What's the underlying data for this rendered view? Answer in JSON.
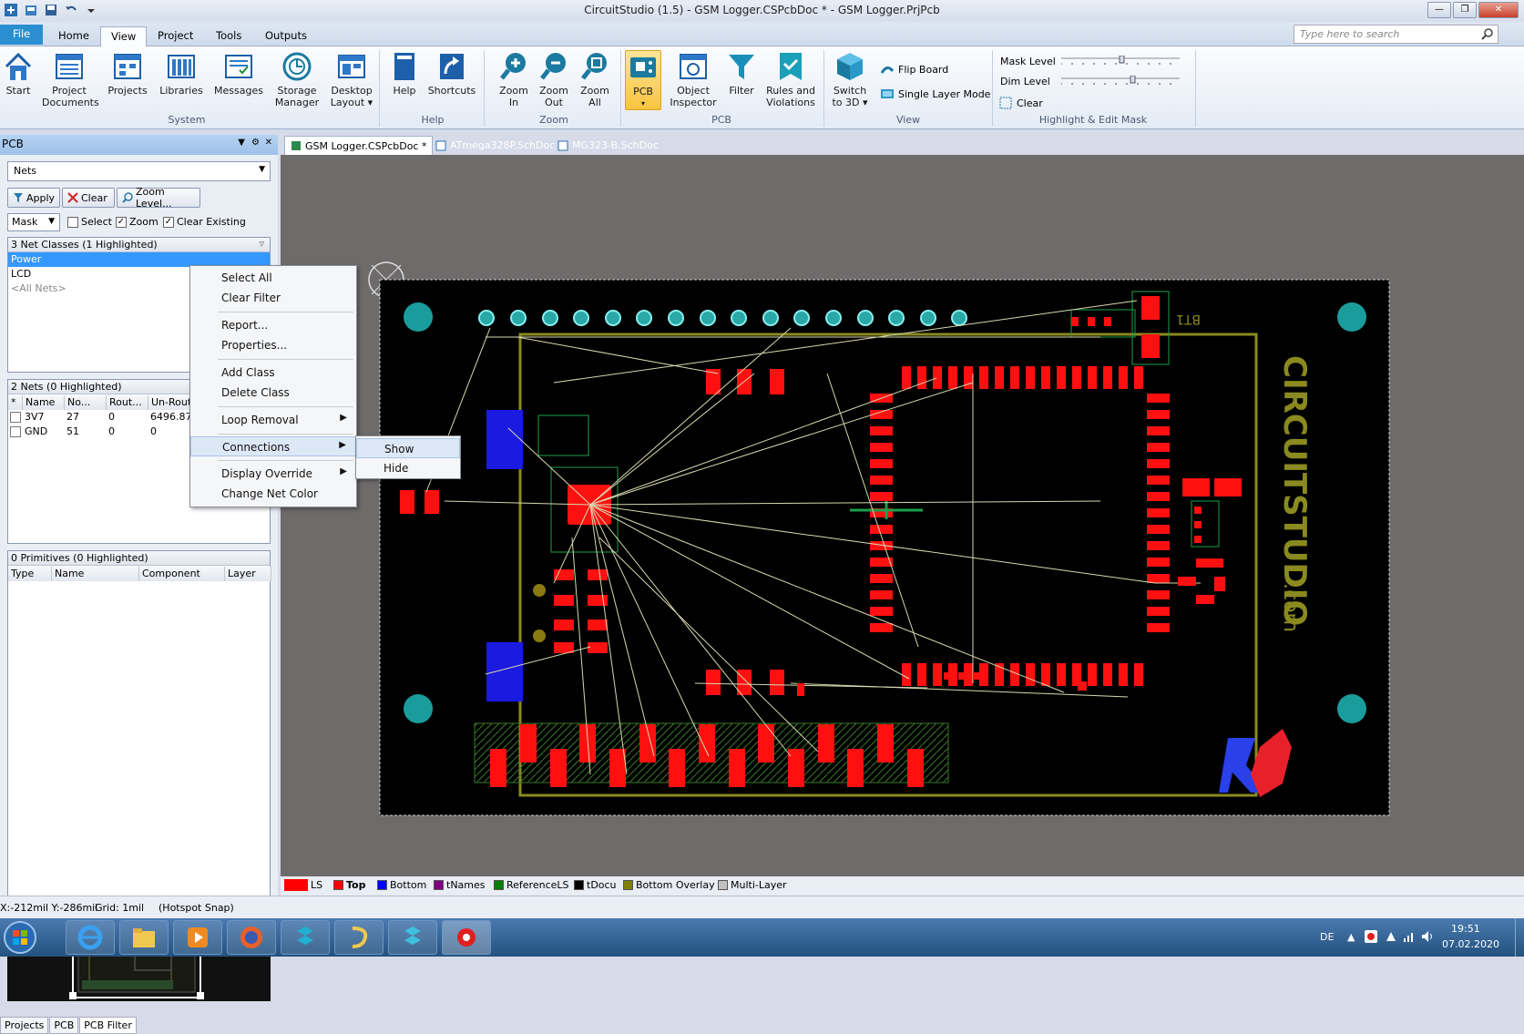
{
  "window": {
    "title": "CircuitStudio (1.5) - GSM Logger.CSPcbDoc * - GSM Logger.PrjPcb"
  },
  "ribbon_tabs": [
    "File",
    "Home",
    "View",
    "Project",
    "Tools",
    "Outputs"
  ],
  "search": {
    "placeholder": "Type here to search"
  },
  "ribbon": {
    "start": "Start",
    "project_documents": [
      "Project",
      "Documents"
    ],
    "projects": "Projects",
    "libraries": "Libraries",
    "messages": "Messages",
    "storage_manager": [
      "Storage",
      "Manager"
    ],
    "desktop_layout": [
      "Desktop",
      "Layout ▾"
    ],
    "help": "Help",
    "shortcuts": "Shortcuts",
    "zoom_in": [
      "Zoom",
      "In"
    ],
    "zoom_out": [
      "Zoom",
      "Out"
    ],
    "zoom_all": [
      "Zoom",
      "All"
    ],
    "pcb": "PCB",
    "object_inspector": [
      "Object",
      "Inspector"
    ],
    "filter": "Filter",
    "rules": [
      "Rules and",
      "Violations"
    ],
    "switch_3d": [
      "Switch",
      "to 3D ▾"
    ],
    "flip_board": "Flip Board",
    "single_layer": "Single Layer Mode",
    "mask_level": "Mask Level",
    "dim_level": "Dim Level",
    "clear": "Clear",
    "groups": {
      "system": "System",
      "help": "Help",
      "zoom": "Zoom",
      "pcb": "PCB",
      "view": "View",
      "highlight": "Highlight & Edit Mask"
    }
  },
  "panel": {
    "title": "PCB",
    "mode": "Nets",
    "apply": "Apply",
    "clear": "Clear",
    "zoom_level": "Zoom Level...",
    "mask": "Mask",
    "select": "Select",
    "zoom": "Zoom",
    "clear_existing": "Clear Existing",
    "net_classes_header": "3 Net Classes (1 Highlighted)",
    "net_classes": [
      "Power",
      "LCD",
      "<All Nets>"
    ],
    "nets_header": "2 Nets (0 Highlighted)",
    "nets_columns": [
      "*",
      "Name",
      "No...",
      "Rout...",
      "Un-Rout"
    ],
    "nets": [
      {
        "name": "3V7",
        "nodes": "27",
        "routed": "0",
        "unrouted": "6496.872"
      },
      {
        "name": "GND",
        "nodes": "51",
        "routed": "0",
        "unrouted": "0"
      }
    ],
    "primitives_header": "0 Primitives (0 Highlighted)",
    "primitives_columns": [
      "Type",
      "Name",
      "Component",
      "Layer"
    ]
  },
  "bottom_tabs": [
    "Projects",
    "PCB",
    "PCB Filter"
  ],
  "doc_tabs": [
    "GSM Logger.CSPcbDoc *",
    "ATmega328P.SchDoc",
    "MG323-B.SchDoc"
  ],
  "context_menu": {
    "items": [
      "Select All",
      "Clear Filter",
      "Report...",
      "Properties...",
      "Add Class",
      "Delete Class",
      "Loop Removal",
      "Connections",
      "Display Override",
      "Change Net Color"
    ],
    "submenu": [
      "Show",
      "Hide"
    ]
  },
  "pcb": {
    "silk_label": "BT1",
    "logo_text": "CIRCUITSTUDIO",
    "logo_suffix": ".com"
  },
  "layers": [
    {
      "name": "LS",
      "color": "#ff0000"
    },
    {
      "name": "Top",
      "color": "#ff0000"
    },
    {
      "name": "Bottom",
      "color": "#0000ff"
    },
    {
      "name": "tNames",
      "color": "#800080"
    },
    {
      "name": "ReferenceLS",
      "color": "#008000"
    },
    {
      "name": "tDocu",
      "color": "#000000"
    },
    {
      "name": "Bottom Overlay",
      "color": "#808000"
    },
    {
      "name": "Multi-Layer",
      "color": "#c0c0c0"
    }
  ],
  "status": {
    "coords": "X:-212mil Y:-286mil",
    "grid": "Grid: 1mil",
    "snap": "(Hotspot Snap)"
  },
  "tray": {
    "lang": "DE",
    "time": "19:51",
    "date": "07.02.2020"
  }
}
